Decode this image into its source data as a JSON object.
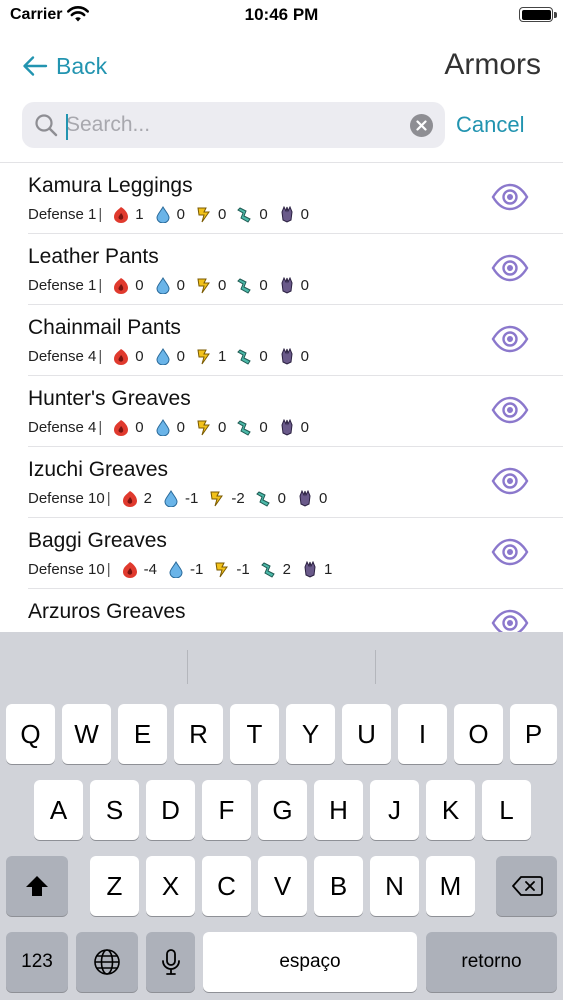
{
  "status": {
    "carrier": "Carrier",
    "time": "10:46 PM"
  },
  "nav": {
    "back_label": "Back",
    "title": "Armors"
  },
  "search": {
    "placeholder": "Search...",
    "value": "",
    "cancel_label": "Cancel"
  },
  "colors": {
    "accent": "#2294b0",
    "eye": "#8b78cc",
    "fire": "#e03a2e",
    "water": "#6ab4e8",
    "thunder": "#f2c21b",
    "ice": "#4cb8a8",
    "dragon": "#6a5a8a"
  },
  "labels": {
    "defense": "Defense",
    "separator": "|"
  },
  "armors": [
    {
      "name": "Kamura Leggings",
      "defense": "1",
      "fire": "1",
      "water": "0",
      "thunder": "0",
      "ice": "0",
      "dragon": "0"
    },
    {
      "name": "Leather Pants",
      "defense": "1",
      "fire": "0",
      "water": "0",
      "thunder": "0",
      "ice": "0",
      "dragon": "0"
    },
    {
      "name": "Chainmail Pants",
      "defense": "4",
      "fire": "0",
      "water": "0",
      "thunder": "1",
      "ice": "0",
      "dragon": "0"
    },
    {
      "name": "Hunter's Greaves",
      "defense": "4",
      "fire": "0",
      "water": "0",
      "thunder": "0",
      "ice": "0",
      "dragon": "0"
    },
    {
      "name": "Izuchi Greaves",
      "defense": "10",
      "fire": "2",
      "water": "-1",
      "thunder": "-2",
      "ice": "0",
      "dragon": "0"
    },
    {
      "name": "Baggi Greaves",
      "defense": "10",
      "fire": "-4",
      "water": "-1",
      "thunder": "-1",
      "ice": "2",
      "dragon": "1"
    },
    {
      "name": "Arzuros Greaves",
      "defense": "",
      "fire": "",
      "water": "",
      "thunder": "",
      "ice": "",
      "dragon": ""
    }
  ],
  "keyboard": {
    "row1": [
      "Q",
      "W",
      "E",
      "R",
      "T",
      "Y",
      "U",
      "I",
      "O",
      "P"
    ],
    "row2": [
      "A",
      "S",
      "D",
      "F",
      "G",
      "H",
      "J",
      "K",
      "L"
    ],
    "row3": [
      "Z",
      "X",
      "C",
      "V",
      "B",
      "N",
      "M"
    ],
    "numbers_label": "123",
    "space_label": "espaço",
    "return_label": "retorno"
  }
}
